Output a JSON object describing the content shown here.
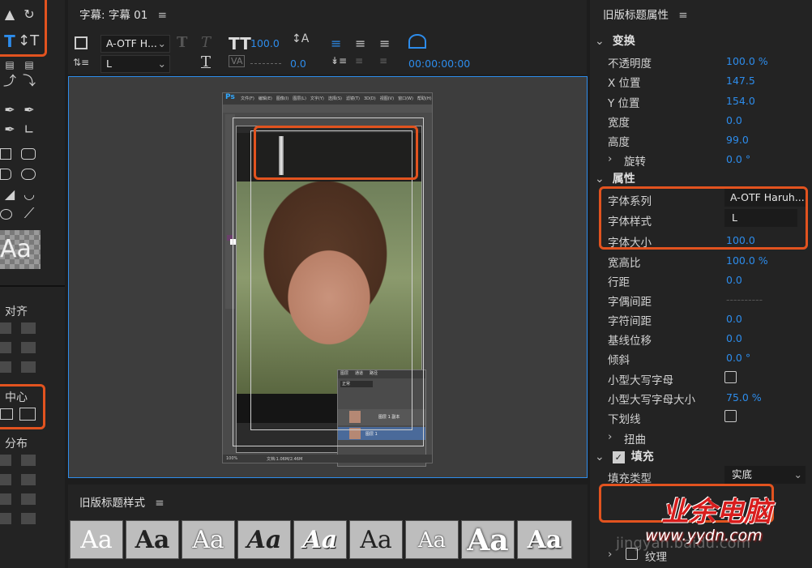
{
  "left_toolbar": {
    "tools": [
      "selection-tool",
      "rotate-tool",
      "type-tool",
      "vertical-type-tool",
      "area-type-tool",
      "vertical-area-type-tool",
      "path-type-tool",
      "vertical-path-type-tool",
      "pen-tool",
      "delete-anchor-tool",
      "add-anchor-tool",
      "convert-anchor-tool",
      "rectangle-tool",
      "rounded-rect-tool",
      "clipped-rect-tool",
      "rounded-rect-2-tool",
      "wedge-tool",
      "arc-tool",
      "ellipse-tool",
      "line-tool"
    ],
    "preview_text": "Aa",
    "align_label": "对齐",
    "center_label": "中心",
    "distribute_label": "分布"
  },
  "title_panel": {
    "title": "字幕: 字幕 01",
    "font_family": "A-OTF H...",
    "font_style": "L",
    "font_size": "100.0",
    "kerning": "0.0",
    "timecode": "00:00:00:00"
  },
  "photoshop": {
    "logo": "Ps",
    "menu": [
      "文件(F)",
      "编辑(E)",
      "图像(I)",
      "图层(L)",
      "文字(Y)",
      "选择(S)",
      "滤镜(T)",
      "3D(D)",
      "视图(V)",
      "窗口(W)",
      "帮助(H)"
    ],
    "layers_tabs": [
      "图层",
      "通道",
      "路径"
    ],
    "blend_mode": "正常",
    "layer_copy_name": "图层 1 副本",
    "layer_name": "图层 1",
    "zoom": "100%",
    "doc_info": "文档:1.06M/2.46M"
  },
  "styles_panel": {
    "title": "旧版标题样式",
    "samples": [
      "Aa",
      "Aa",
      "Aa",
      "Aa",
      "Aa",
      "Aa",
      "Aa",
      "Aa",
      "Aa"
    ]
  },
  "properties": {
    "title": "旧版标题属性",
    "transform_label": "变换",
    "opacity": {
      "label": "不透明度",
      "value": "100.0 %"
    },
    "x": {
      "label": "X 位置",
      "value": "147.5"
    },
    "y": {
      "label": "Y 位置",
      "value": "154.0"
    },
    "width": {
      "label": "宽度",
      "value": "0.0"
    },
    "height": {
      "label": "高度",
      "value": "99.0"
    },
    "rotation": {
      "label": "旋转",
      "value": "0.0 °"
    },
    "attributes_label": "属性",
    "font_family": {
      "label": "字体系列",
      "value": "A-OTF Haruh..."
    },
    "font_style": {
      "label": "字体样式",
      "value": "L"
    },
    "font_size": {
      "label": "字体大小",
      "value": "100.0"
    },
    "aspect": {
      "label": "宽高比",
      "value": "100.0 %"
    },
    "leading": {
      "label": "行距",
      "value": "0.0"
    },
    "kerning": {
      "label": "字偶间距",
      "value": "----------"
    },
    "tracking": {
      "label": "字符间距",
      "value": "0.0"
    },
    "baseline": {
      "label": "基线位移",
      "value": "0.0"
    },
    "slant": {
      "label": "倾斜",
      "value": "0.0 °"
    },
    "small_caps": {
      "label": "小型大写字母"
    },
    "small_caps_size": {
      "label": "小型大写字母大小",
      "value": "75.0 %"
    },
    "underline": {
      "label": "下划线"
    },
    "distort": {
      "label": "扭曲"
    },
    "fill_label": "填充",
    "fill_type": {
      "label": "填充类型",
      "value": "实底"
    },
    "texture": {
      "label": "纹理"
    }
  },
  "watermark": {
    "brand": "业余电脑",
    "url": "www.yydn.com",
    "baidu": "jingyan.baidu.com"
  },
  "colors": {
    "accent": "#2d8ceb",
    "highlight": "#e2531f",
    "panel_bg": "#232323"
  }
}
